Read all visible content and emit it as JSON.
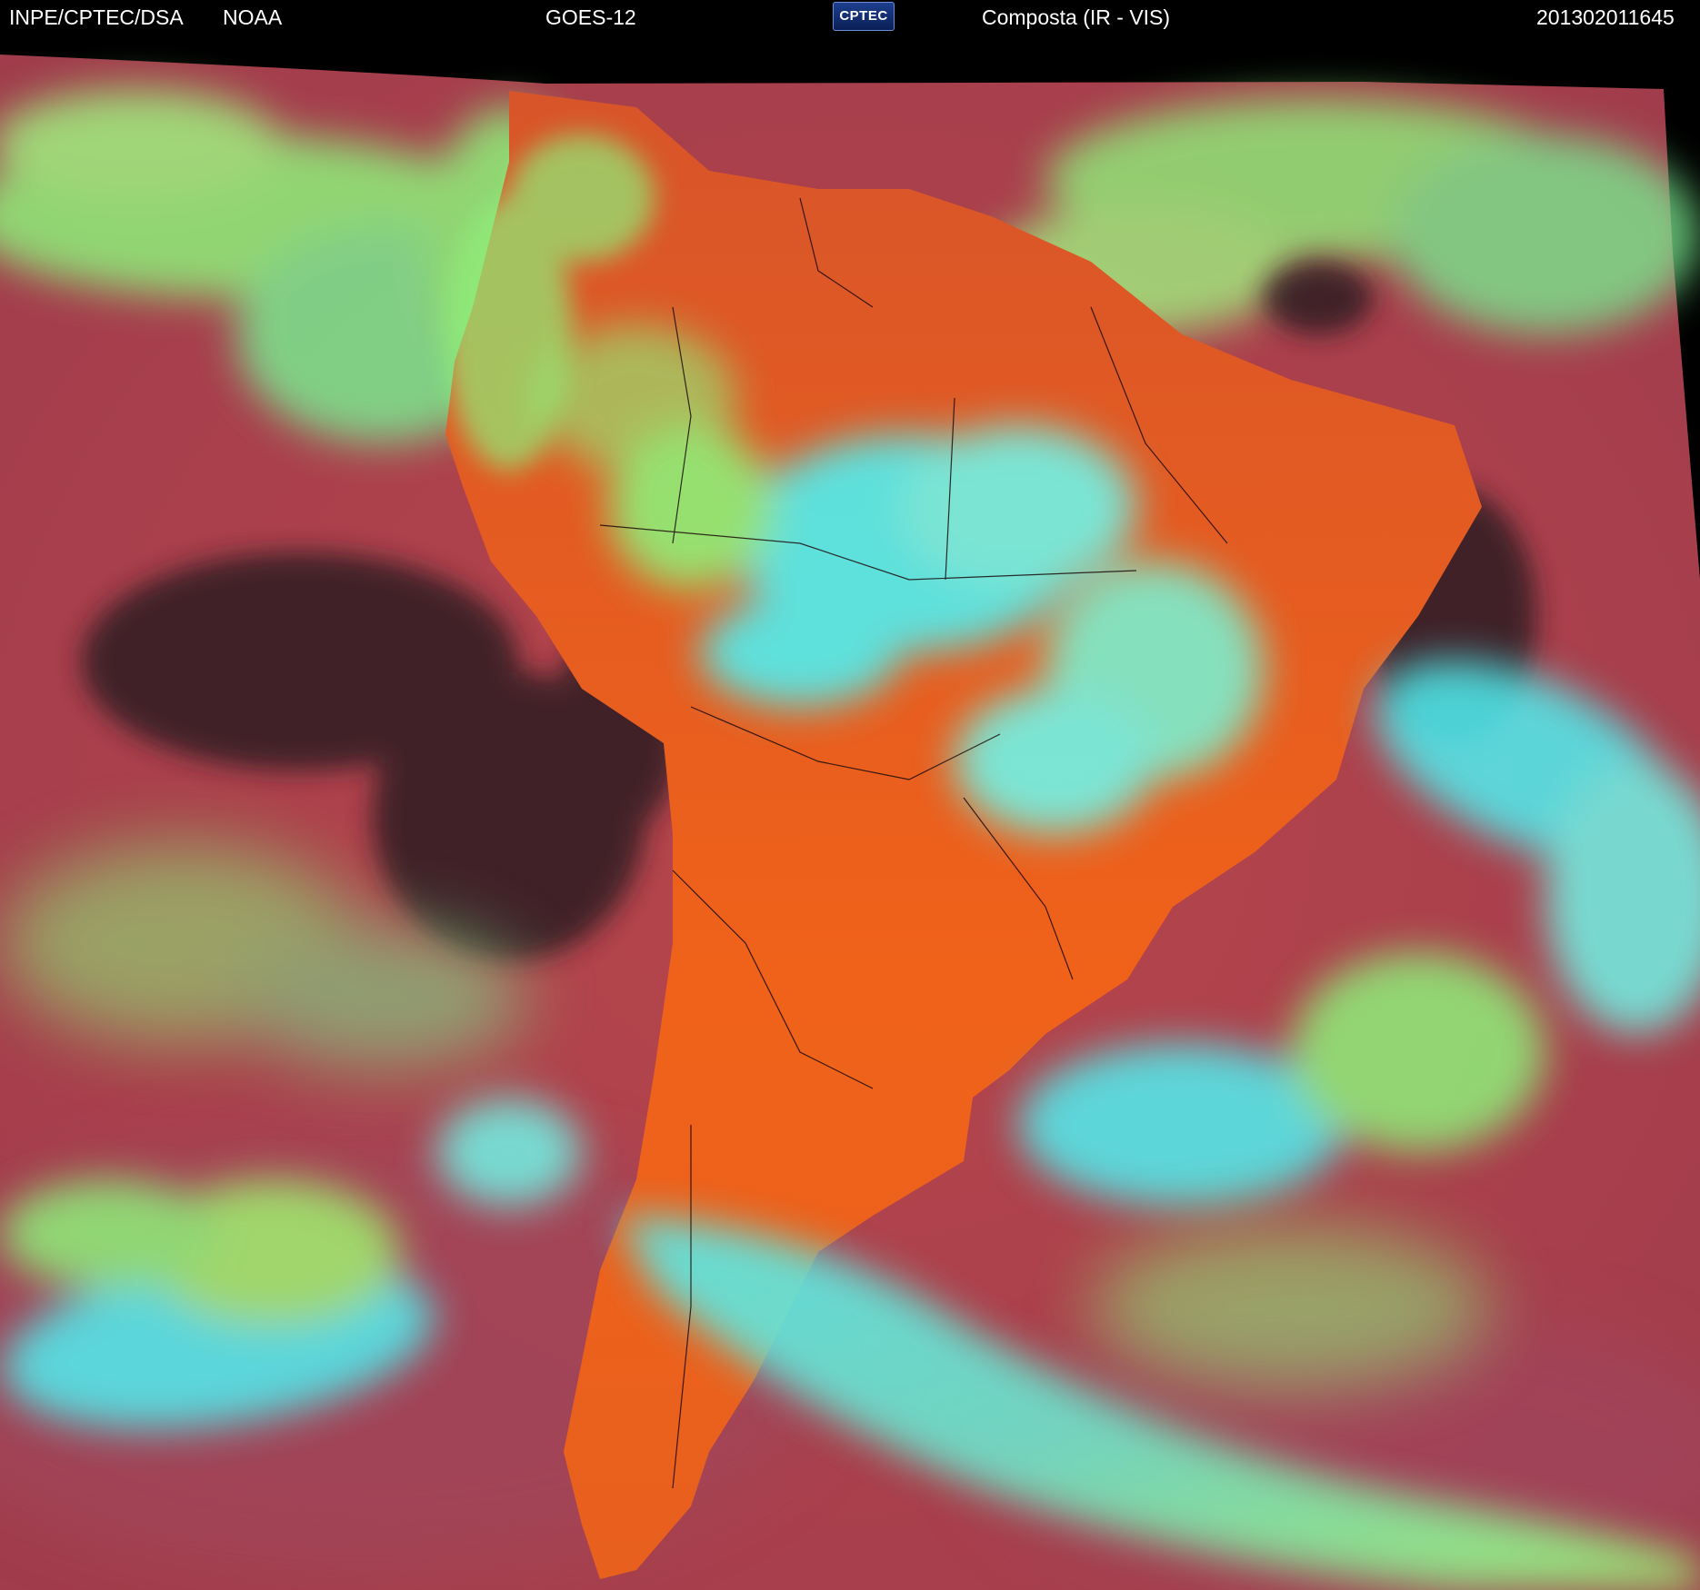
{
  "header": {
    "agency": "INPE/CPTEC/DSA",
    "partner": "NOAA",
    "satellite": "GOES-12",
    "logo_text": "CPTEC",
    "product": "Composta (IR - VIS)",
    "timestamp": "201302011645"
  },
  "image": {
    "subject": "South America",
    "colors": {
      "ocean": "#b0424a",
      "land": "#e85a1e",
      "low_cloud": "#8ef07a",
      "high_cloud": "#4ff0f2",
      "clear_dark": "#2a1a1a",
      "space": "#000000"
    }
  }
}
